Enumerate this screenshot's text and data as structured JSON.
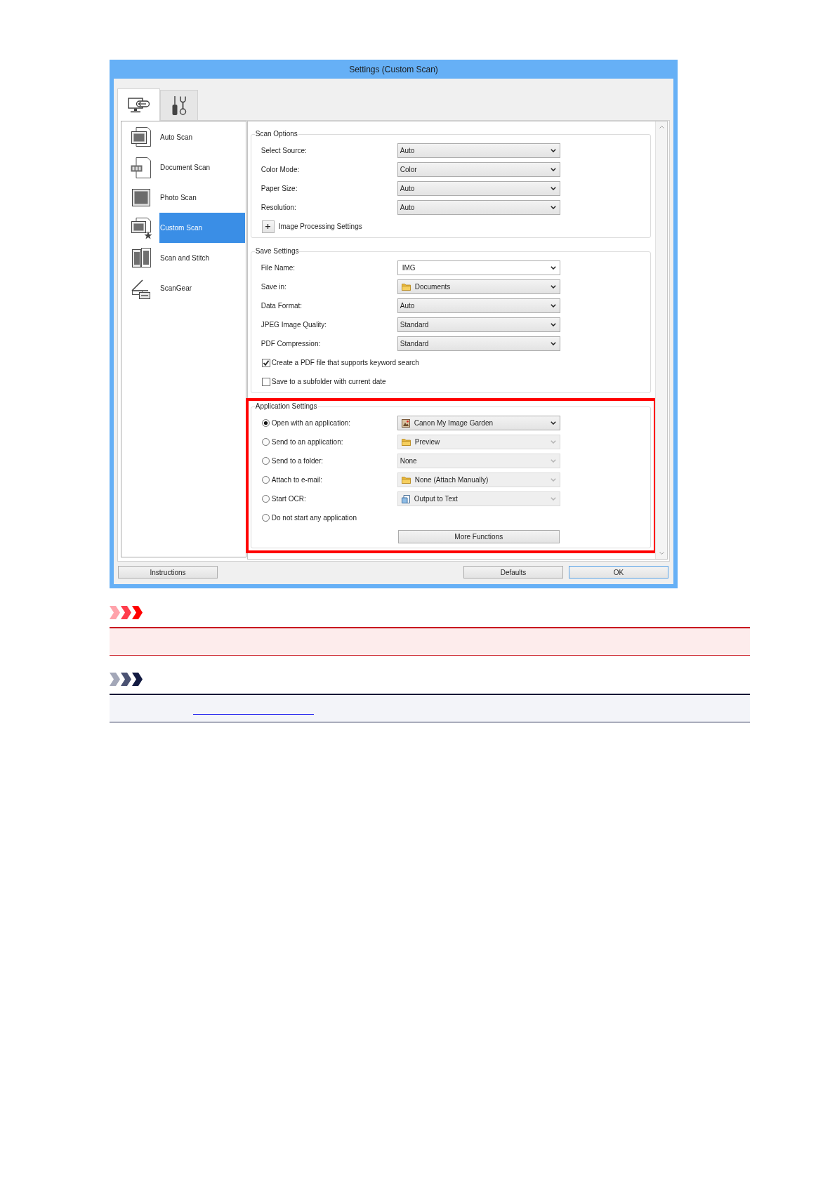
{
  "window": {
    "title": "Settings (Custom Scan)"
  },
  "tabs": [
    {
      "kind": "scan",
      "selected": true
    },
    {
      "kind": "tools",
      "selected": false
    }
  ],
  "sidebar": {
    "items": [
      {
        "kind": "auto",
        "label": "Auto Scan",
        "selected": false
      },
      {
        "kind": "document",
        "label": "Document Scan",
        "selected": false
      },
      {
        "kind": "photo",
        "label": "Photo Scan",
        "selected": false
      },
      {
        "kind": "custom",
        "label": "Custom Scan",
        "selected": true
      },
      {
        "kind": "stitch",
        "label": "Scan and Stitch",
        "selected": false
      },
      {
        "kind": "scangear",
        "label": "ScanGear",
        "selected": false
      }
    ]
  },
  "groups": [
    {
      "title": "Scan Options",
      "highlighted": false,
      "rows": [
        {
          "kind": "dropdown",
          "label": "Select Source:",
          "value": "Auto",
          "disabled": false
        },
        {
          "kind": "dropdown",
          "label": "Color Mode:",
          "value": "Color",
          "disabled": false
        },
        {
          "kind": "dropdown",
          "label": "Paper Size:",
          "value": "Auto",
          "disabled": false
        },
        {
          "kind": "dropdown",
          "label": "Resolution:",
          "value": "Auto",
          "disabled": false
        },
        {
          "kind": "expander",
          "label": "Image Processing Settings",
          "expanded": false
        }
      ]
    },
    {
      "title": "Save Settings",
      "highlighted": false,
      "rows": [
        {
          "kind": "combo",
          "label": "File Name:",
          "value": "IMG",
          "disabled": false
        },
        {
          "kind": "dropdown",
          "label": "Save in:",
          "value": "Documents",
          "icon": {
            "kind": "folder"
          },
          "disabled": false
        },
        {
          "kind": "dropdown",
          "label": "Data Format:",
          "value": "Auto",
          "disabled": false
        },
        {
          "kind": "dropdown",
          "label": "JPEG Image Quality:",
          "value": "Standard",
          "disabled": false
        },
        {
          "kind": "dropdown",
          "label": "PDF Compression:",
          "value": "Standard",
          "disabled": false
        },
        {
          "kind": "checkbox",
          "label": "Create a PDF file that supports keyword search",
          "checked": true
        },
        {
          "kind": "checkbox",
          "label": "Save to a subfolder with current date",
          "checked": false
        }
      ]
    },
    {
      "title": "Application Settings",
      "highlighted": true,
      "rows": [
        {
          "kind": "radio",
          "label": "Open with an application:",
          "selected": true,
          "dropdown": {
            "value": "Canon My Image Garden",
            "icon": {
              "kind": "picture"
            },
            "disabled": false
          }
        },
        {
          "kind": "radio",
          "label": "Send to an application:",
          "selected": false,
          "dropdown": {
            "value": "Preview",
            "icon": {
              "kind": "folder"
            },
            "disabled": true
          }
        },
        {
          "kind": "radio",
          "label": "Send to a folder:",
          "selected": false,
          "dropdown": {
            "value": "None",
            "disabled": true
          }
        },
        {
          "kind": "radio",
          "label": "Attach to e-mail:",
          "selected": false,
          "dropdown": {
            "value": "None (Attach Manually)",
            "icon": {
              "kind": "folder"
            },
            "disabled": true
          }
        },
        {
          "kind": "radio",
          "label": "Start OCR:",
          "selected": false,
          "dropdown": {
            "value": "Output to Text",
            "icon": {
              "kind": "document"
            },
            "disabled": true
          }
        },
        {
          "kind": "radio",
          "label": "Do not start any application",
          "selected": false
        },
        {
          "kind": "button",
          "label": "More Functions"
        }
      ]
    }
  ],
  "buttons": [
    {
      "label": "Instructions",
      "default": false
    },
    {
      "label": "Defaults",
      "default": false
    },
    {
      "label": "OK",
      "default": true
    }
  ],
  "notices": [
    {
      "kind": "important",
      "link": false
    },
    {
      "kind": "note",
      "link": true
    }
  ]
}
